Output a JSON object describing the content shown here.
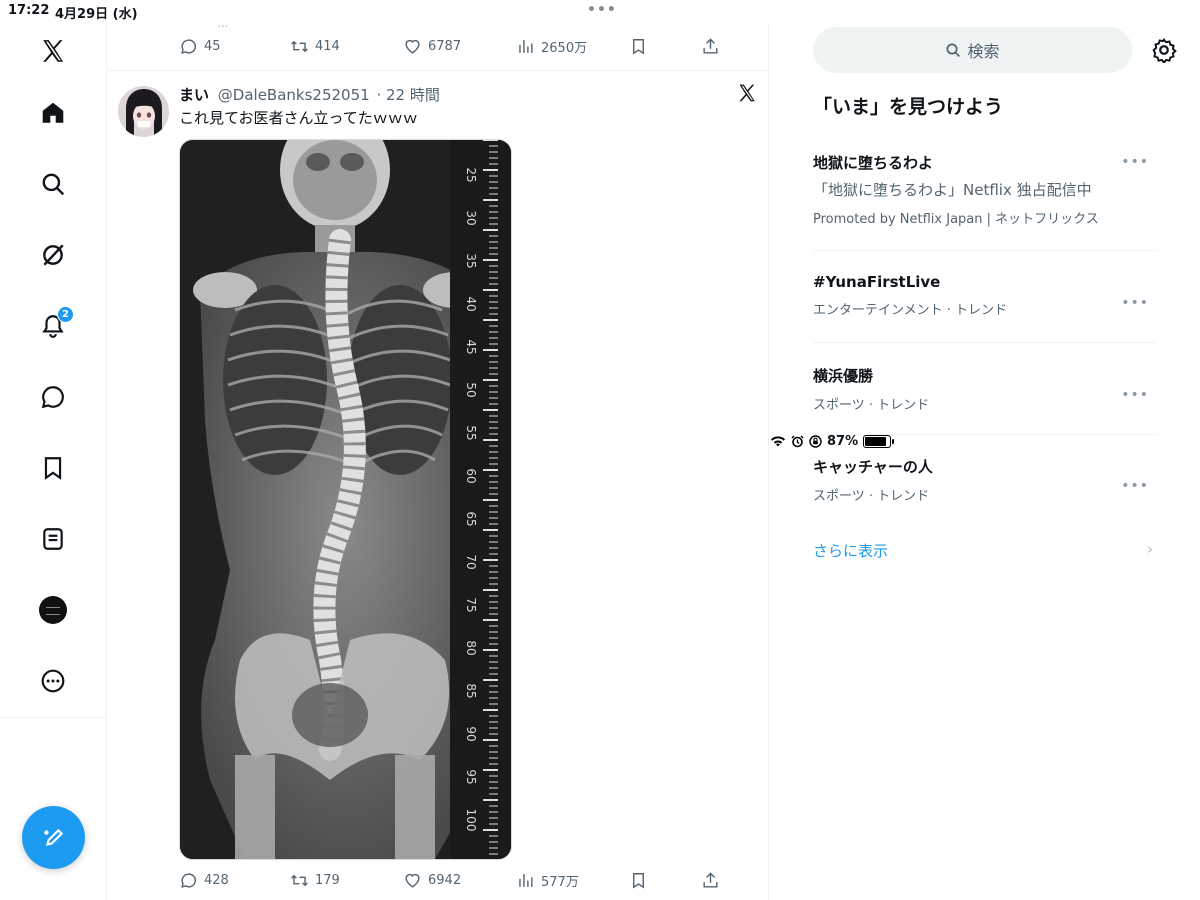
{
  "status_bar": {
    "time": "17:22",
    "date": "4月29日 (水)",
    "battery_text": "87%",
    "battery_level": 0.87
  },
  "nav": {
    "items": [
      "x-logo",
      "home-icon",
      "search-icon",
      "grok-icon",
      "notifications-icon",
      "messages-icon",
      "bookmarks-icon",
      "lists-icon",
      "profile-avatar",
      "more-icon"
    ],
    "notification_count": "2"
  },
  "previous_post": {
    "replies": "45",
    "reposts": "414",
    "likes": "6787",
    "views": "2650万"
  },
  "post": {
    "name": "まい",
    "handle": "@DaleBanks252051",
    "time": "· 22 時間",
    "text": "これ見てお医者さん立ってたｗｗｗ",
    "ruler_labels": [
      "25",
      "30",
      "35",
      "40",
      "45",
      "50",
      "55",
      "60",
      "65",
      "70",
      "75",
      "80",
      "85",
      "90",
      "95",
      "100"
    ],
    "replies": "428",
    "reposts": "179",
    "likes": "6942",
    "views": "577万"
  },
  "sidebar": {
    "search_placeholder": "検索",
    "section_title": "「いま」を見つけよう",
    "trends": [
      {
        "name": "地獄に堕ちるわよ",
        "desc": "「地獄に堕ちるわよ」Netflix 独占配信中",
        "meta": "Promoted by Netflix Japan | ネットフリックス"
      },
      {
        "name": "#YunaFirstLive",
        "meta": "エンターテインメント · トレンド"
      },
      {
        "name": "横浜優勝",
        "meta": "スポーツ · トレンド"
      },
      {
        "name": "キャッチャーの人",
        "meta": "スポーツ · トレンド"
      }
    ],
    "show_more": "さらに表示"
  },
  "colors": {
    "accent": "#1d9bf0",
    "text": "#0f1419",
    "secondary": "#536471",
    "divider": "#eff3f4"
  }
}
